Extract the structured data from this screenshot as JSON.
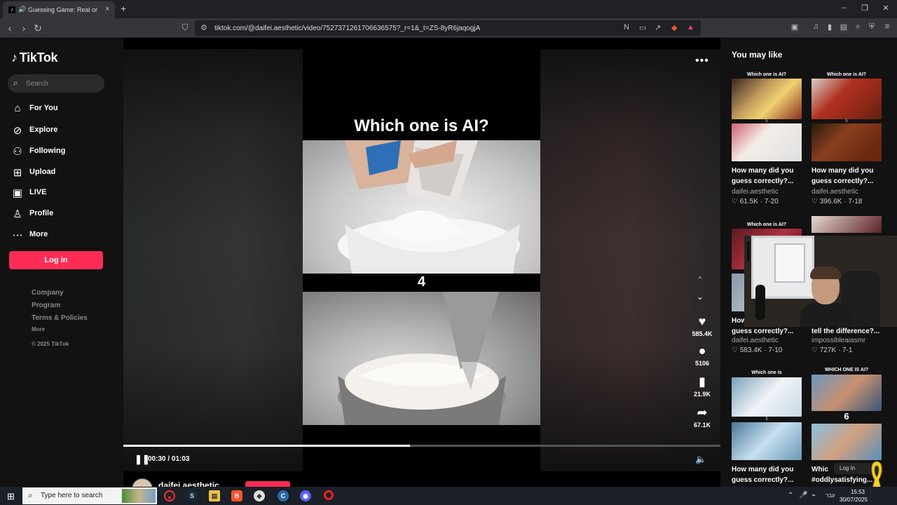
{
  "browser": {
    "tab_title": "Guessing Game: Real or Fake",
    "tab_close": "×",
    "new_tab": "+",
    "url": "tiktok.com/@daifei.aesthetic/video/7527371261706636575?_r=1&_t=ZS-8yR6jaqogjA",
    "window_minimize": "–",
    "window_restore": "❐",
    "window_close": "✕"
  },
  "sidebar": {
    "logo_text": "TikTok",
    "search_placeholder": "Search",
    "nav": [
      {
        "label": "For You",
        "icon": "home-icon"
      },
      {
        "label": "Explore",
        "icon": "compass-icon"
      },
      {
        "label": "Following",
        "icon": "following-icon"
      },
      {
        "label": "Upload",
        "icon": "upload-icon"
      },
      {
        "label": "LIVE",
        "icon": "live-icon"
      },
      {
        "label": "Profile",
        "icon": "profile-icon"
      },
      {
        "label": "More",
        "icon": "more-icon"
      }
    ],
    "login_label": "Log in",
    "footer": {
      "company": "Company",
      "program": "Program",
      "terms": "Terms & Policies",
      "more": "More",
      "copyright": "© 2025 TikTok"
    }
  },
  "video": {
    "question": "Which one is AI?",
    "countdown": "4",
    "likes": "585.4K",
    "comments": "5106",
    "saves": "21.9K",
    "shares": "67.1K",
    "time": "00:30 / 01:03",
    "progress": 0.48,
    "author": "daifei.aesthetic"
  },
  "rail": {
    "title": "You may like",
    "cards": [
      {
        "label": "Which one is AI?",
        "sub": "5",
        "caption": "How many did you guess correctly?...",
        "author": "daifei.aesthetic",
        "stats": "♡ 61.5K · 7-20"
      },
      {
        "label": "Which one is AI?",
        "sub": "5",
        "caption": "How many did you guess correctly?...",
        "author": "daifei.aesthetic",
        "stats": "♡ 396.6K · 7-18"
      },
      {
        "label": "Which one is AI?",
        "sub": "",
        "caption": "How many did you guess correctly?...",
        "author": "daifei.aesthetic",
        "stats": "♡ 583.4K · 7-10"
      },
      {
        "label": "",
        "sub": "",
        "caption": "tell the difference?...",
        "author": "impossibleaiasmr",
        "stats": "♡ 727K · 7-1"
      },
      {
        "label": "Which one is",
        "sub": "5",
        "caption": "How many did you guess correctly?...",
        "author": "",
        "stats": ""
      },
      {
        "label": "WHICH ONE IS AI?",
        "sub": "6",
        "caption": "Whic #oddlysatisfying...",
        "author": "",
        "stats": ""
      }
    ],
    "overlay_login": "Log In"
  },
  "taskbar": {
    "search_placeholder": "Type here to search",
    "time": "15:53",
    "date": "30/07/2025",
    "lang": "עבר"
  },
  "colors": {
    "accent": "#fe2c55",
    "sidebar_bg": "#121212"
  }
}
